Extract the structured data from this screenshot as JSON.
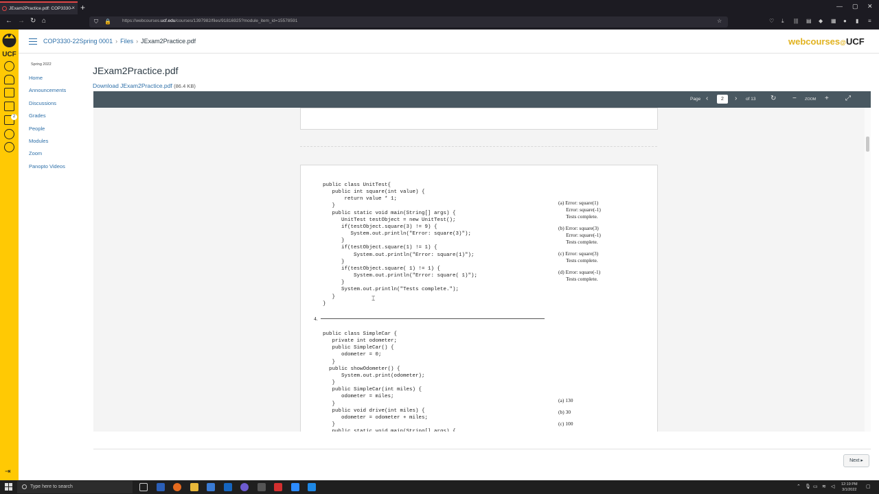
{
  "browser": {
    "tab_title": "JExam2Practice.pdf: COP3330-",
    "url_prefix": "https://webcourses.",
    "url_domain": "ucf.edu",
    "url_rest": "/courses/1397982/files/91816925?module_item_id=15578591"
  },
  "breadcrumb": {
    "course": "COP3330-22Spring 0001",
    "files": "Files",
    "current": "JExam2Practice.pdf"
  },
  "brand": {
    "web": "webcourses",
    "at": "@",
    "ucf": "UCF",
    "rail_logo": "UCF"
  },
  "course_nav": {
    "term": "Spring 2022",
    "items": [
      "Home",
      "Announcements",
      "Discussions",
      "Grades",
      "People",
      "Modules",
      "Zoom",
      "Panopto Videos"
    ]
  },
  "rail": {
    "inbox_badge": "2"
  },
  "page": {
    "title": "JExam2Practice.pdf",
    "download_label": "Download JExam2Practice.pdf",
    "file_size": "(86.4 KB)"
  },
  "viewer": {
    "page_label": "Page",
    "page_value": "2",
    "page_total": "of 13",
    "zoom_label": "ZOOM"
  },
  "pdf": {
    "q3_code": "public class UnitTest{\n   public int square(int value) {\n       return value * 1;\n   }\n   public static void main(String[] args) {\n      UnitTest testObject = new UnitTest();\n      if(testObject.square(3) != 9) {\n         System.out.println(\"Error: square(3)\");\n      }\n      if(testObject.square(1) != 1) {\n          System.out.println(\"Error: square(1)\");\n      }\n      if(testObject.square( 1) != 1) {\n          System.out.println(\"Error: square( 1)\");\n      }\n      System.out.println(\"Tests complete.\");\n   }\n}",
    "q3_options": [
      "(a) Error: square(1)\n      Error: square(-1)\n      Tests complete.",
      "(b) Error: square(3)\n      Error: square(-1)\n      Tests complete.",
      "(c) Error: square(3)\n      Tests complete.",
      "(d) Error: square(-1)\n      Tests complete."
    ],
    "q4_number": "4.",
    "q4_code": "public class SimpleCar {\n   private int odometer;\n   public SimpleCar() {\n      odometer = 0;\n   }\n  public showOdometer() {\n      System.out.print(odometer);\n   }\n   public SimpleCar(int miles) {\n      odometer = miles;\n   }\n   public void drive(int miles) {\n      odometer = odometer + miles;\n   }\n   public static void main(String[] args) {",
    "q4_options": [
      "(a) 130",
      "(b) 30",
      "(c) 100"
    ]
  },
  "footer": {
    "next_label": "Next ▸"
  },
  "taskbar": {
    "search_placeholder": "Type here to search",
    "time": "12:19 PM",
    "date": "3/1/2022"
  },
  "colors": {
    "ucf_gold": "#ffc904",
    "link": "#2d6fa8",
    "toolbar": "#495861"
  }
}
